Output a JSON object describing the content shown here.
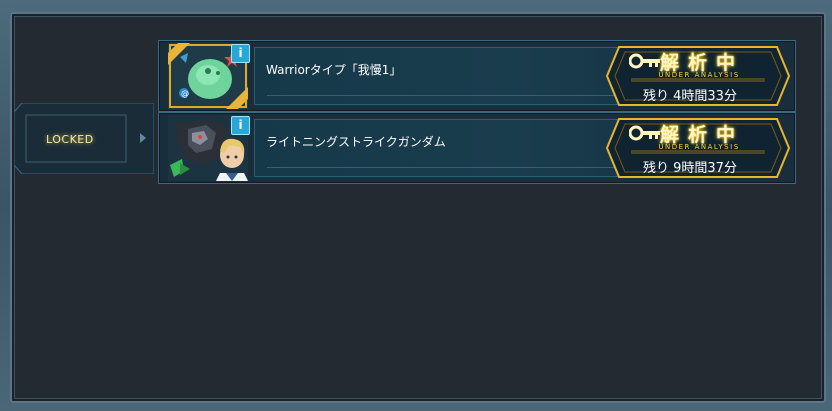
{
  "items": [
    {
      "title": "Warriorタイプ「我慢1」",
      "status_main": "解析中",
      "status_sub": "UNDER ANALYSIS",
      "remaining": "残り 4時間33分",
      "info_icon": "i",
      "locked": false
    },
    {
      "title": "ライトニングストライクガンダム",
      "status_main": "解析中",
      "status_sub": "UNDER ANALYSIS",
      "remaining": "残り 9時間37分",
      "info_icon": "i",
      "locked": true,
      "locked_label": "LOCKED"
    }
  ],
  "colors": {
    "frame_bg": "#242a31",
    "row_bg": "#1a3d4e",
    "accent_gold": "#ffcf3a",
    "info_blue": "#27a8d6"
  },
  "icons": [
    "key-icon",
    "info-icon",
    "green-zaku-thumbnail",
    "gundam-pilot-thumbnail"
  ]
}
